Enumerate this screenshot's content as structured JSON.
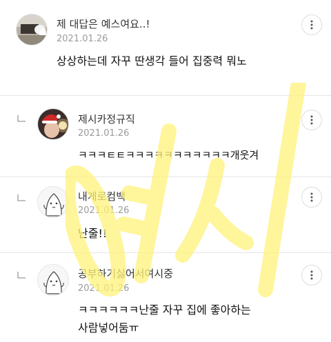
{
  "comments": [
    {
      "name": "제 대답은 예스여요..!",
      "date": "2021.01.26",
      "text_lines": [
        "상상하는데 자꾸 딴생각 들어 집중력 뭐노"
      ],
      "is_reply": false,
      "avatar": "photo-avatar"
    },
    {
      "name": "제시카정규직",
      "date": "2021.01.26",
      "text_lines": [
        "ㅋㅋㅋㅌㅌㅋㅋㅋㅋㅋㅋㅋㅋㅋㅋㅋ개웃겨"
      ],
      "is_reply": true,
      "avatar": "santa-hat-avatar"
    },
    {
      "name": "내게로컴백",
      "date": "2021.01.26",
      "text_lines": [
        "난줄!!"
      ],
      "is_reply": true,
      "avatar": "default-character-avatar"
    },
    {
      "name": "공부하기싫어서여시중",
      "date": "2021.01.26",
      "text_lines": [
        "ㅋㅋㅋㅋㅋㅋ난줄 자꾸 집에 좋아하는",
        "사람넣어둠ㅠ"
      ],
      "is_reply": true,
      "avatar": "default-character-avatar"
    }
  ],
  "watermark": {
    "text": "여시",
    "color": "#fff27a"
  },
  "icons": {
    "more": "more-vertical-icon",
    "reply": "reply-arrow-icon"
  }
}
